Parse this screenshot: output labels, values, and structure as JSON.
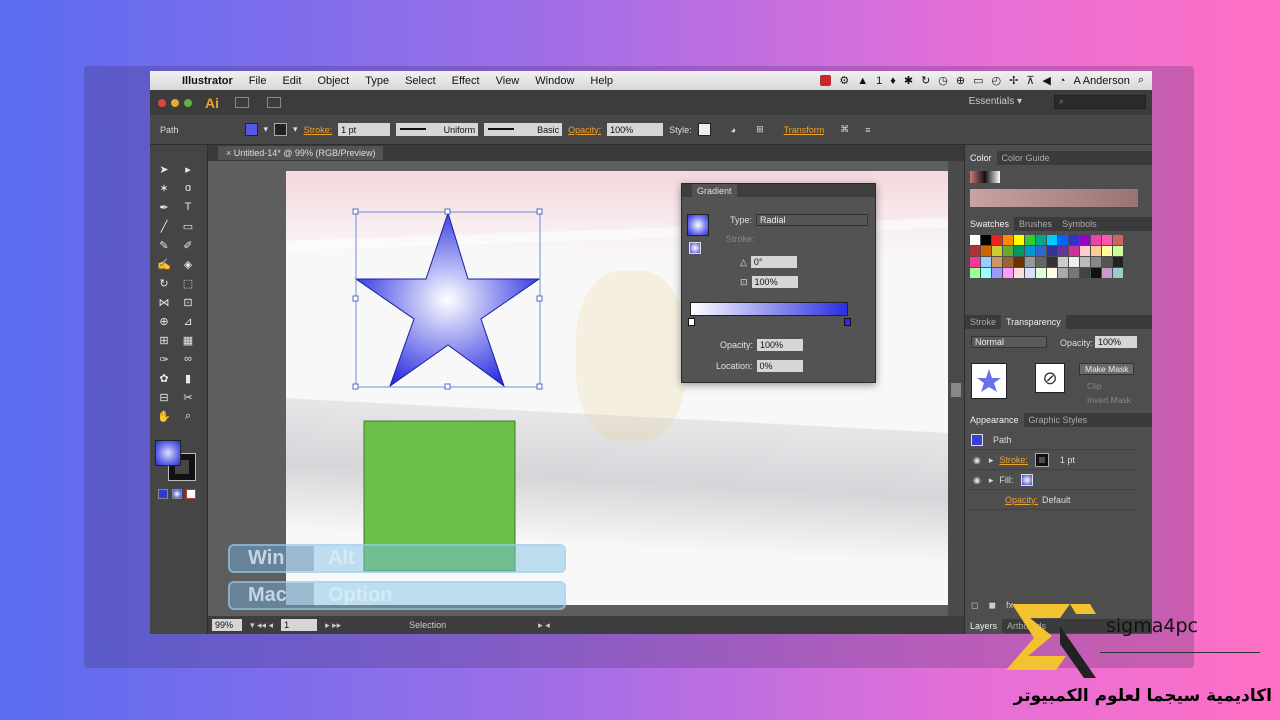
{
  "menubar": {
    "app_name": "Illustrator",
    "items": [
      "File",
      "Edit",
      "Object",
      "Type",
      "Select",
      "Effect",
      "View",
      "Window",
      "Help"
    ],
    "status_count": "1",
    "user": "A Anderson"
  },
  "appbar": {
    "logo": "Ai",
    "workspace": "Essentials ▾"
  },
  "controlbar": {
    "selection_label": "Path",
    "stroke_label": "Stroke:",
    "stroke_value": "1 pt",
    "profile_value": "Uniform",
    "brush_value": "Basic",
    "opacity_label": "Opacity:",
    "opacity_value": "100%",
    "style_label": "Style:",
    "transform_label": "Transform"
  },
  "document": {
    "tab_title": "Untitled-14* @ 99% (RGB/Preview)",
    "zoom": "99%",
    "artboard_number": "1",
    "status_text": "Selection"
  },
  "gradient_panel": {
    "title": "Gradient",
    "type_label": "Type:",
    "type_value": "Radial",
    "stroke_label": "Stroke:",
    "angle_value": "0°",
    "aspect_value": "100%",
    "opacity_label": "Opacity:",
    "opacity_value": "100%",
    "location_label": "Location:",
    "location_value": "0%",
    "colors": {
      "start": "#ffffff",
      "end": "#2a2ee0"
    }
  },
  "right_panels": {
    "color_tabs": [
      "Color",
      "Color Guide"
    ],
    "swatch_tabs": [
      "Swatches",
      "Brushes",
      "Symbols"
    ],
    "transparency_tabs": [
      "Stroke",
      "Transparency"
    ],
    "blend_mode": "Normal",
    "opacity_label": "Opacity:",
    "opacity_value": "100%",
    "make_mask": "Make Mask",
    "clip": "Clip",
    "invert_mask": "Invert Mask",
    "appearance_tabs": [
      "Appearance",
      "Graphic Styles"
    ],
    "appearance_title": "Path",
    "appearance_stroke_label": "Stroke:",
    "appearance_stroke_value": "1 pt",
    "appearance_fill_label": "Fill:",
    "appearance_opacity_label": "Opacity:",
    "appearance_opacity_value": "Default",
    "bottom_tabs": [
      "Layers",
      "Artboards"
    ]
  },
  "shortcuts": [
    {
      "key": "Mac",
      "value": "Option"
    },
    {
      "key": "Win",
      "value": "Alt"
    }
  ],
  "brand": {
    "name": "sigma4pc",
    "arabic": "اكاديمية سيجما لعلوم الكمبيوتر"
  },
  "colors": {
    "star_center": "#ffffff",
    "star_edge": "#2a2ee0",
    "rect_fill": "#6cc04a",
    "accent": "#f0a12b"
  }
}
